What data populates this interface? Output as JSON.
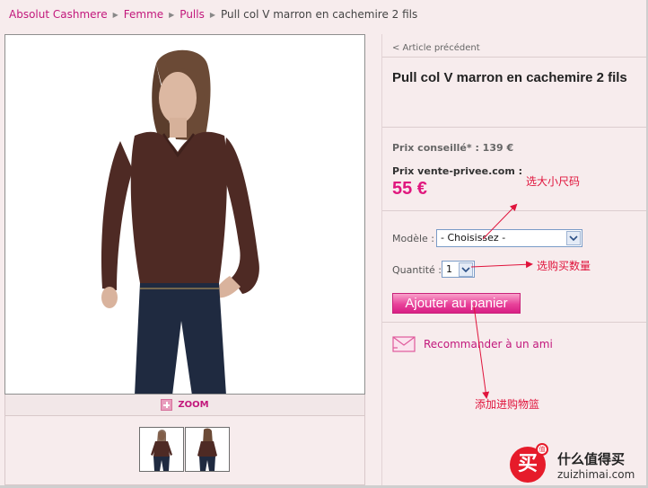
{
  "breadcrumb": {
    "items": [
      "Absolut Cashmere",
      "Femme",
      "Pulls"
    ],
    "current": "Pull col V marron en cachemire 2 fils",
    "separator": "▶"
  },
  "gallery": {
    "zoom_label": "ZOOM",
    "thumbnail_count": 2
  },
  "product": {
    "prev_link": "< Article précédent",
    "title": "Pull col V marron en cachemire 2 fils",
    "advised_price": "Prix conseillé* : 139 €",
    "sale_label": "Prix vente-privee.com :",
    "sale_price": "55 €",
    "model_label": "Modèle :",
    "model_value": "- Choisissez -",
    "qty_label": "Quantité :",
    "qty_value": "1",
    "add_to_cart": "Ajouter au panier",
    "recommend": "Recommander à un ami"
  },
  "annotations": {
    "size": "选大小尺码",
    "quantity": "选购买数量",
    "cart": "添加进购物篮"
  },
  "watermark": {
    "badge_char": "买",
    "dot_char": "值",
    "name": "什么值得买",
    "url": "zuizhimai.com"
  },
  "colors": {
    "accent": "#c2187c",
    "price": "#e0177e",
    "annotation": "#e0143c",
    "sweater": "#4e2a24",
    "jeans": "#1f2a40"
  }
}
